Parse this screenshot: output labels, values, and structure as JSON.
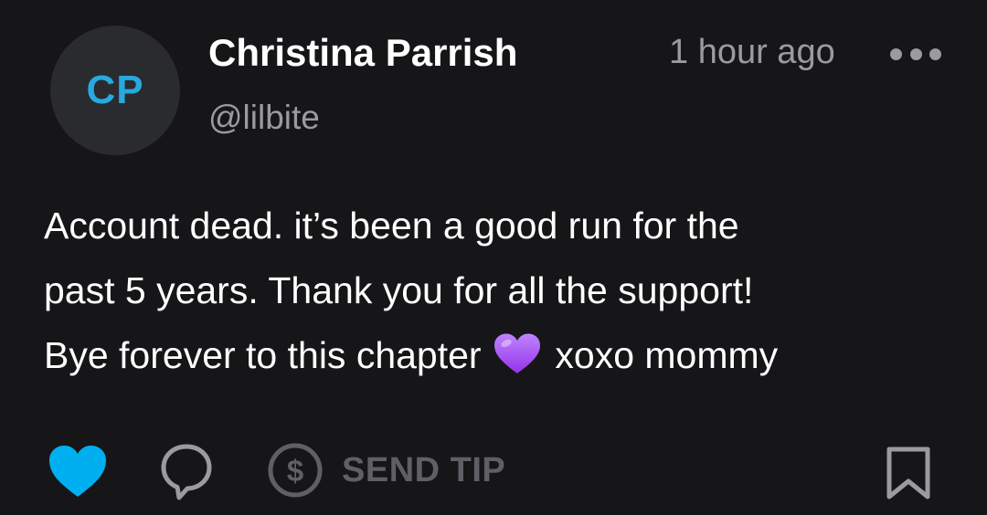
{
  "post": {
    "author": {
      "initials": "CP",
      "name": "Christina Parrish",
      "handle": "@lilbite"
    },
    "timestamp": "1 hour ago",
    "text_lines": [
      "Account dead. it’s been a good run for the",
      "past 5 years. Thank you for all the support!",
      "Bye forever to this chapter",
      "xoxo mommy"
    ],
    "emoji": "purple-heart",
    "actions": {
      "send_tip_label": "SEND TIP"
    }
  },
  "icons": {
    "like": "heart-icon",
    "comment": "comment-icon",
    "tip": "dollar-icon",
    "bookmark": "bookmark-icon",
    "more": "more-options-icon"
  },
  "colors": {
    "background": "#161618",
    "accent": "#27a9e1",
    "like_active": "#00aff0",
    "muted": "#9a9ba0",
    "disabled": "#5f6066",
    "avatar_bg": "#2a2b2f",
    "emoji_purple": "#a855f7"
  }
}
